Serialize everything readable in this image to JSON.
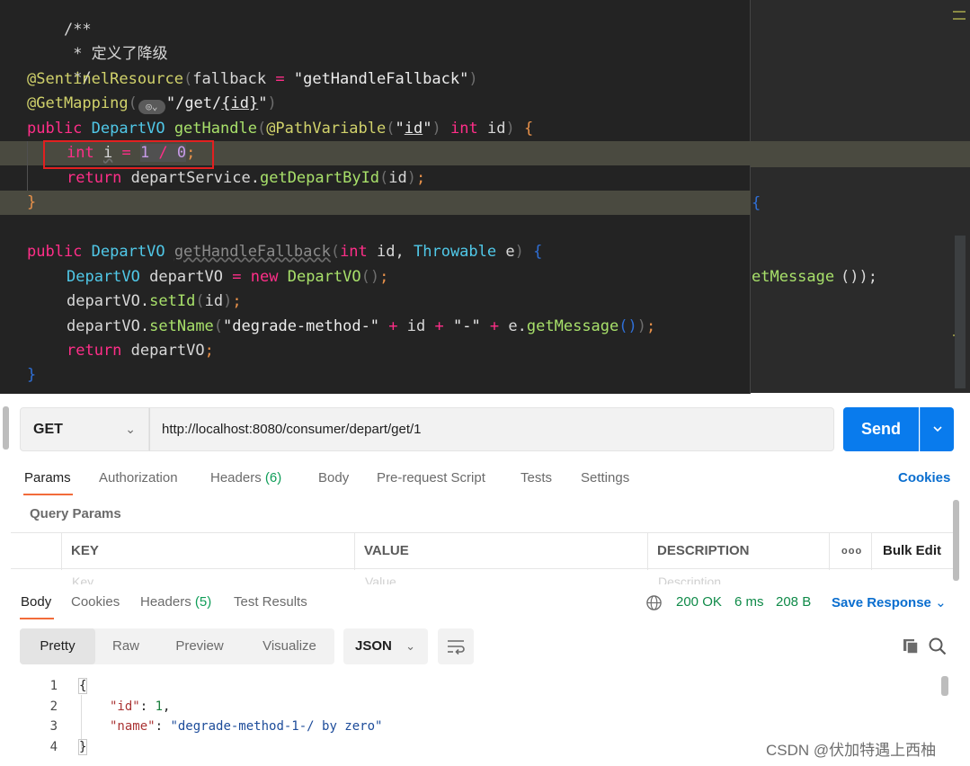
{
  "colors": {
    "editor_bg": "#232323",
    "keyword": "#ff2e88",
    "type": "#50c8e8",
    "method": "#a8e06a",
    "annotation": "#d1d26b",
    "number": "#c79be8",
    "highlight_box": "#e22020",
    "send_button": "#097bed",
    "status_ok": "#0f8a48",
    "active_tab_underline": "#f26b3a",
    "link": "#0a6ecf"
  },
  "code": {
    "comment_open": "/**",
    "comment_body": " * 定义了降级",
    "comment_close": " */",
    "sentinel_anno": "@SentinelResource",
    "fallback_key": "fallback",
    "fallback_eq": " = ",
    "fallback_value": "\"getHandleFallback\"",
    "getmapping_anno": "@GetMapping",
    "getmapping_path_prefix": "\"/get/",
    "getmapping_path_var": "{id}",
    "getmapping_path_suffix": "\"",
    "kw_public": "public",
    "type_departvo": "DepartVO",
    "method_gethandle": "getHandle",
    "pathvariable_anno": "@PathVariable",
    "pathvariable_value_q1": "\"",
    "pathvariable_value": "id",
    "pathvariable_value_q2": "\"",
    "kw_int": "int",
    "param_id": "id",
    "var_i": "i",
    "op_eq": " = ",
    "expr_one": "1",
    "expr_div": " / ",
    "expr_zero": "0",
    "semicolon": ";",
    "kw_return": "return",
    "service_name": "departService",
    "dot": ".",
    "method_getdepartbyid": "getDepartById",
    "close_brace": "}",
    "open_brace": "{",
    "method_gethandlefallback": "getHandleFallback",
    "type_throwable": "Throwable",
    "param_e": "e",
    "var_departvo": "departVO",
    "kw_new": "new",
    "method_setid": "setId",
    "method_setname": "setName",
    "string_degrade": "\"degrade-method-\"",
    "op_plus": " + ",
    "string_dash": "\"-\"",
    "method_getmessage": "getMessage",
    "bg_fragment_1": "{",
    "bg_fragment_2": "etMessage",
    "bg_fragment_3": "());"
  },
  "request": {
    "method": "GET",
    "url": "http://localhost:8080/consumer/depart/get/1",
    "send_label": "Send",
    "tabs": [
      {
        "label": "Params"
      },
      {
        "label": "Authorization"
      },
      {
        "label": "Headers",
        "count": "(6)"
      },
      {
        "label": "Body"
      },
      {
        "label": "Pre-request Script"
      },
      {
        "label": "Tests"
      },
      {
        "label": "Settings"
      }
    ],
    "cookies_link": "Cookies",
    "query_params_title": "Query Params",
    "table_headers": [
      "KEY",
      "VALUE",
      "DESCRIPTION"
    ],
    "bulk_edit": "Bulk Edit",
    "more_dots": "ooo",
    "placeholders": [
      "Key",
      "Value",
      "Description"
    ]
  },
  "response": {
    "tabs": [
      {
        "label": "Body"
      },
      {
        "label": "Cookies"
      },
      {
        "label": "Headers",
        "count": "(5)"
      },
      {
        "label": "Test Results"
      }
    ],
    "status": "200 OK",
    "time": "6 ms",
    "size": "208 B",
    "save_response": "Save Response",
    "view_modes": [
      "Pretty",
      "Raw",
      "Preview",
      "Visualize"
    ],
    "format": "JSON",
    "body_lines": [
      {
        "num": "1",
        "text": "{"
      },
      {
        "num": "2",
        "key": "\"id\"",
        "value": "1",
        "trail": ","
      },
      {
        "num": "3",
        "key": "\"name\"",
        "value": "\"degrade-method-1-/ by zero\""
      },
      {
        "num": "4",
        "text": "}"
      }
    ],
    "colon": ": "
  },
  "watermark": "CSDN @伏加特遇上西柚"
}
